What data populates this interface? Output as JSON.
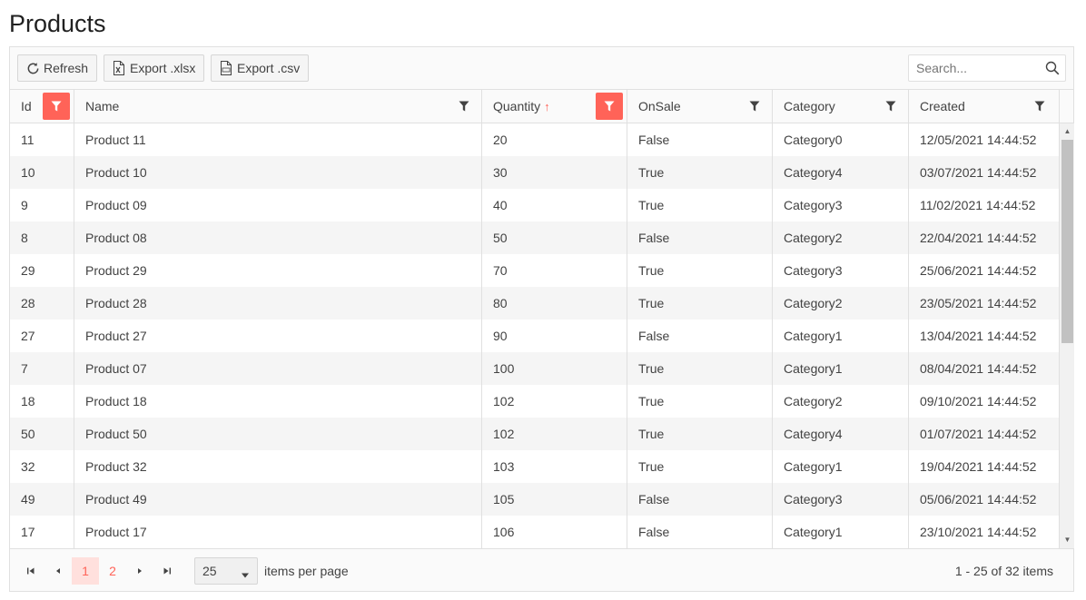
{
  "page": {
    "title": "Products"
  },
  "toolbar": {
    "refresh_label": "Refresh",
    "export_xlsx_label": "Export .xlsx",
    "export_csv_label": "Export .csv",
    "search_placeholder": "Search...",
    "search_value": ""
  },
  "columns": [
    {
      "label": "Id",
      "filter_active": true,
      "sort": ""
    },
    {
      "label": "Name",
      "filter_active": false,
      "sort": ""
    },
    {
      "label": "Quantity",
      "filter_active": true,
      "sort": "asc",
      "sort_glyph": "↑"
    },
    {
      "label": "OnSale",
      "filter_active": false,
      "sort": ""
    },
    {
      "label": "Category",
      "filter_active": false,
      "sort": ""
    },
    {
      "label": "Created",
      "filter_active": false,
      "sort": ""
    }
  ],
  "rows": [
    [
      "11",
      "Product 11",
      "20",
      "False",
      "Category0",
      "12/05/2021 14:44:52"
    ],
    [
      "10",
      "Product 10",
      "30",
      "True",
      "Category4",
      "03/07/2021 14:44:52"
    ],
    [
      "9",
      "Product 09",
      "40",
      "True",
      "Category3",
      "11/02/2021 14:44:52"
    ],
    [
      "8",
      "Product 08",
      "50",
      "False",
      "Category2",
      "22/04/2021 14:44:52"
    ],
    [
      "29",
      "Product 29",
      "70",
      "True",
      "Category3",
      "25/06/2021 14:44:52"
    ],
    [
      "28",
      "Product 28",
      "80",
      "True",
      "Category2",
      "23/05/2021 14:44:52"
    ],
    [
      "27",
      "Product 27",
      "90",
      "False",
      "Category1",
      "13/04/2021 14:44:52"
    ],
    [
      "7",
      "Product 07",
      "100",
      "True",
      "Category1",
      "08/04/2021 14:44:52"
    ],
    [
      "18",
      "Product 18",
      "102",
      "True",
      "Category2",
      "09/10/2021 14:44:52"
    ],
    [
      "50",
      "Product 50",
      "102",
      "True",
      "Category4",
      "01/07/2021 14:44:52"
    ],
    [
      "32",
      "Product 32",
      "103",
      "True",
      "Category1",
      "19/04/2021 14:44:52"
    ],
    [
      "49",
      "Product 49",
      "105",
      "False",
      "Category3",
      "05/06/2021 14:44:52"
    ],
    [
      "17",
      "Product 17",
      "106",
      "False",
      "Category1",
      "23/10/2021 14:44:52"
    ]
  ],
  "pager": {
    "pages": [
      "1",
      "2"
    ],
    "current_page": "1",
    "page_size": "25",
    "items_per_page_label": "items per page",
    "info": "1 - 25 of 32 items"
  },
  "colors": {
    "accent": "#ff6358",
    "accent_light": "#ffe0dd",
    "row_alt": "#f5f5f5",
    "border": "#e0e0e0"
  },
  "icons": {
    "refresh": "refresh-icon",
    "xlsx": "file-excel-icon",
    "csv": "file-csv-icon",
    "search": "search-icon",
    "filter": "filter-icon",
    "first": "page-first-icon",
    "prev": "page-prev-icon",
    "next": "page-next-icon",
    "last": "page-last-icon",
    "caret": "caret-down-icon"
  }
}
